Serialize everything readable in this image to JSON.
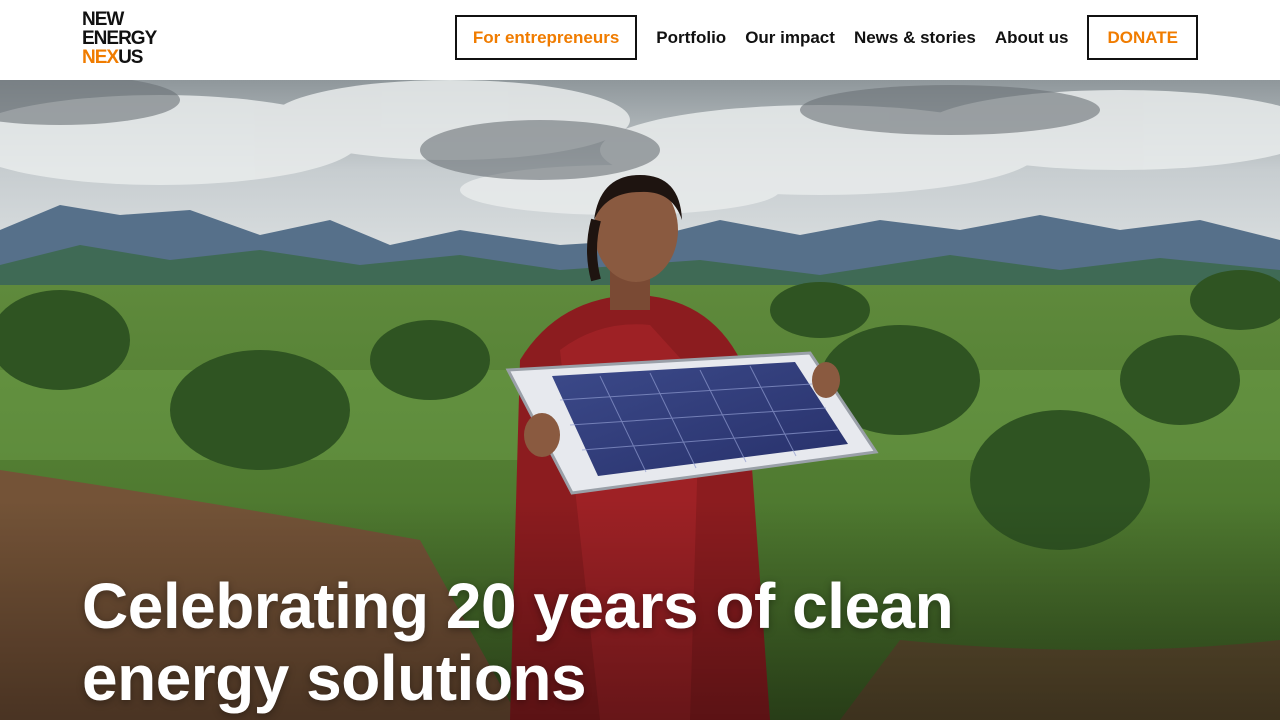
{
  "brand": {
    "logo_line1": "NEW",
    "logo_line2": "ENERGY",
    "logo_line3_accent": "NEX",
    "logo_line3_rest": "US",
    "accent_color": "#f07c00"
  },
  "nav": {
    "cta_label": "For entrepreneurs",
    "links": [
      "Portfolio",
      "Our impact",
      "News & stories",
      "About us"
    ],
    "donate_label": "DONATE"
  },
  "hero": {
    "title": "Celebrating 20 years of clean energy solutions",
    "image_description_icon": "solar-panel-photo"
  }
}
